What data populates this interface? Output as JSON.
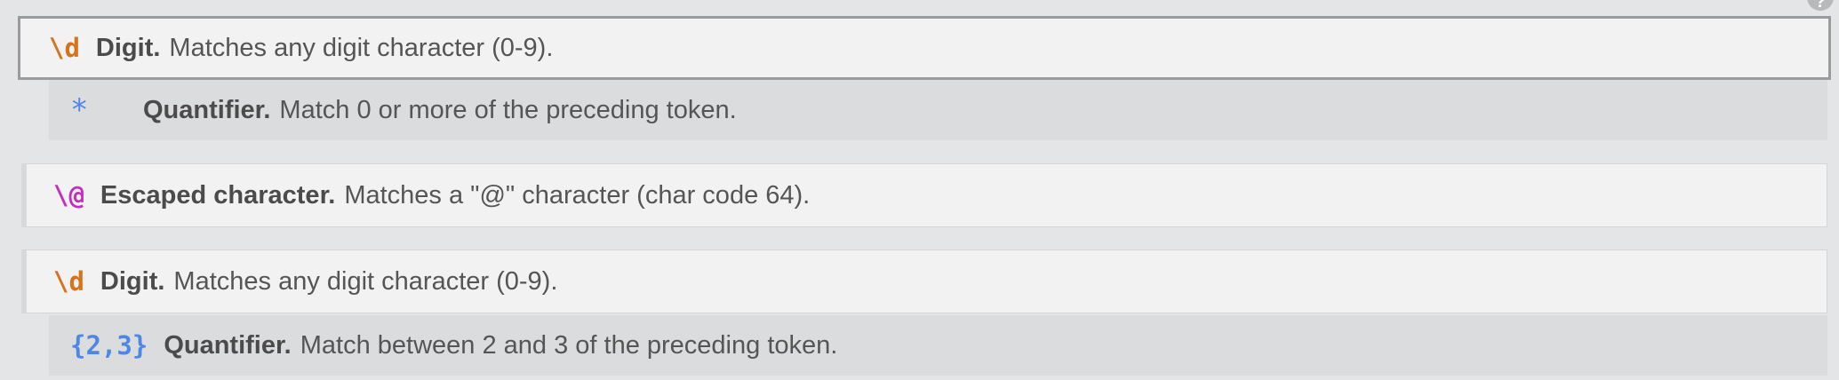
{
  "help_badge": "?",
  "rows": [
    {
      "token": "\\d",
      "label": "Digit.",
      "desc": "Matches any digit character (0-9)."
    },
    {
      "token": "*",
      "label": "Quantifier.",
      "desc": "Match 0 or more of the preceding token."
    },
    {
      "token": "\\@",
      "label": "Escaped character.",
      "desc": "Matches a \"@\" character (char code 64)."
    },
    {
      "token": "\\d",
      "label": "Digit.",
      "desc": "Matches any digit character (0-9)."
    },
    {
      "token": "{2,3}",
      "label": "Quantifier.",
      "desc": "Match between 2 and 3 of the preceding token."
    }
  ],
  "colors": {
    "class_token": "#d6741d",
    "escape_token": "#c42fba",
    "quantifier_token": "#4f86e8"
  }
}
